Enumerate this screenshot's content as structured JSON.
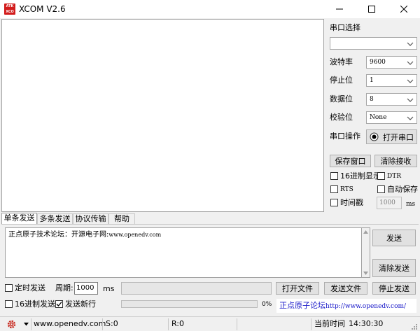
{
  "window": {
    "logo_text": "ATK XCOM",
    "title": "XCOM V2.6"
  },
  "right_panel": {
    "port_select_label": "串口选择",
    "port_value": "",
    "baud_label": "波特率",
    "baud_value": "9600",
    "stop_label": "停止位",
    "stop_value": "1",
    "data_label": "数据位",
    "data_value": "8",
    "parity_label": "校验位",
    "parity_value": "None",
    "operation_label": "串口操作",
    "open_port_label": "打开串口",
    "save_window_label": "保存窗口",
    "clear_receive_label": "清除接收",
    "hex_display_label": "16进制显示",
    "dtr_label": "DTR",
    "rts_label": "RTS",
    "auto_save_label": "自动保存",
    "timestamp_label": "时间戳",
    "timestamp_value": "1000",
    "timestamp_unit": "ms"
  },
  "tabs": [
    "单条发送",
    "多条发送",
    "协议传输",
    "帮助"
  ],
  "send": {
    "input_text_cn": "正点原子技术论坛：开源电子网:",
    "input_text_url": "www.openedv.com",
    "send_label": "发送",
    "clear_send_label": "清除发送",
    "timed_send_label": "定时发送",
    "period_label": "周期:",
    "period_value": "1000",
    "period_unit": "ms",
    "open_file_label": "打开文件",
    "send_file_label": "发送文件",
    "stop_send_label": "停止发送",
    "hex_send_label": "16进制发送",
    "newline_label": "发送新行",
    "progress_text": "0%",
    "progress_value": 0,
    "forum_link_cn": "正点原子论坛",
    "forum_link_url": "http://www.openedv.com/"
  },
  "status_bar": {
    "website": "www.openedv.com",
    "sent": "S:0",
    "received": "R:0",
    "time_label": "当前时间",
    "time_value": "14:30:30"
  },
  "colors": {
    "logo_red": "#d21b1b",
    "link_blue": "#1515c8",
    "gear_red": "#c8281e"
  }
}
